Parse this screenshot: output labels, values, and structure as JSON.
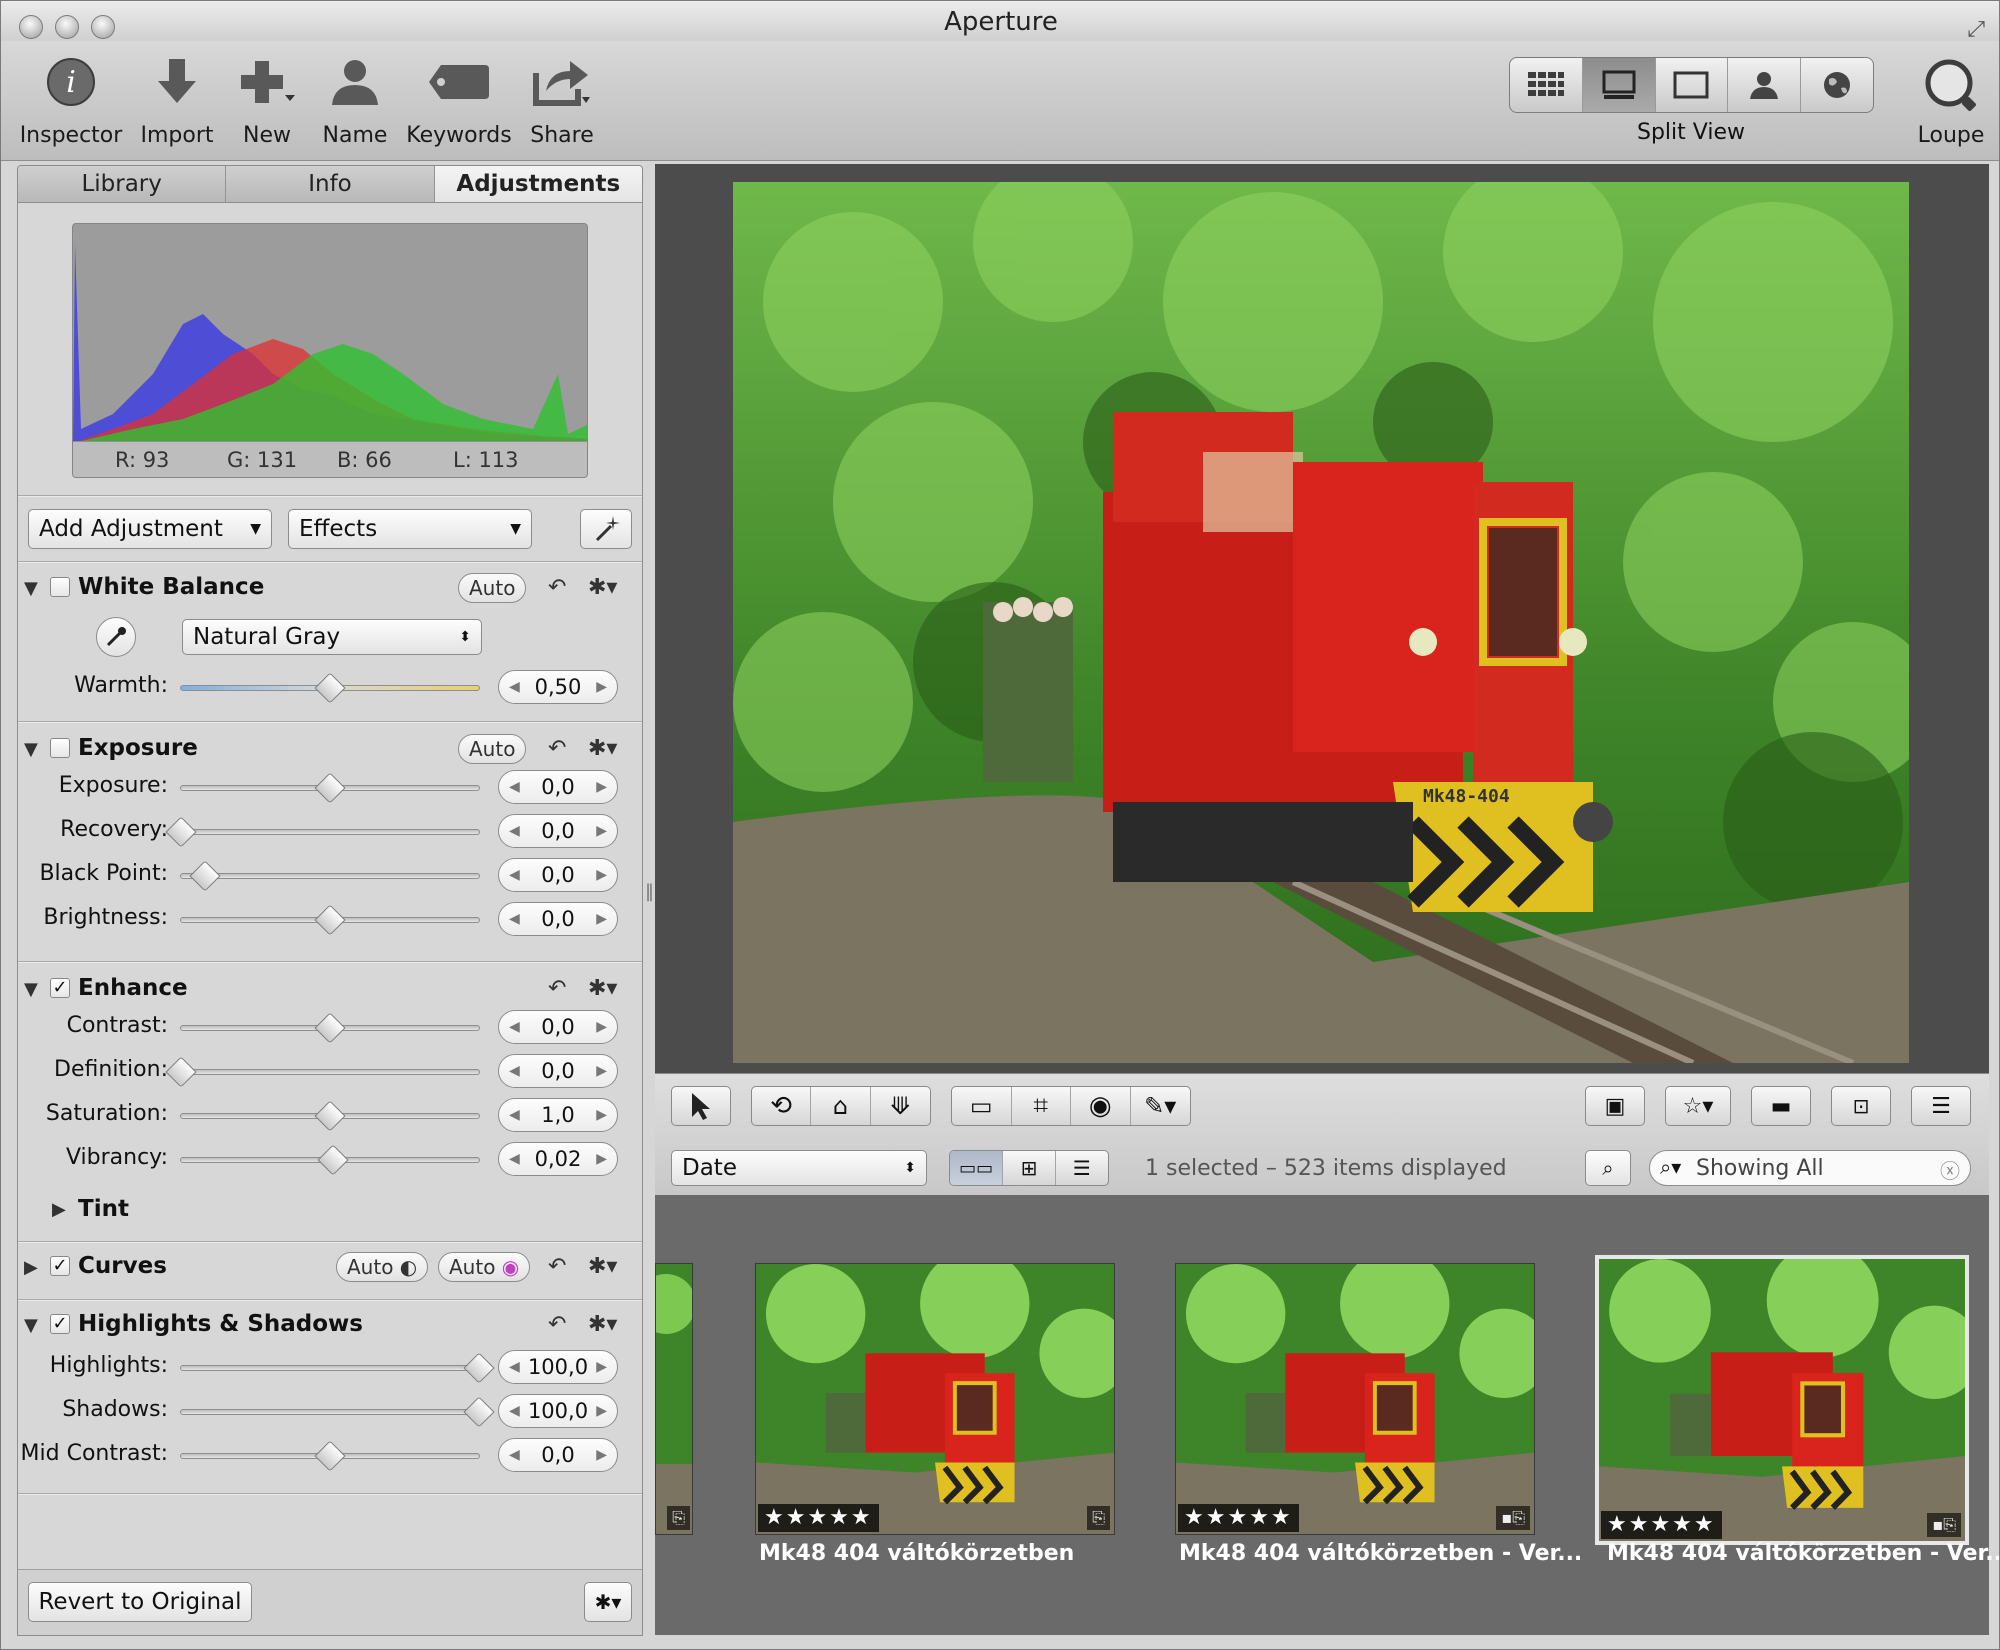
{
  "window": {
    "title": "Aperture"
  },
  "toolbar": {
    "inspector": "Inspector",
    "import": "Import",
    "new": "New",
    "name": "Name",
    "keywords": "Keywords",
    "share": "Share",
    "view_mode": "Split View",
    "loupe": "Loupe"
  },
  "tabs": {
    "library": "Library",
    "info": "Info",
    "adjustments": "Adjustments"
  },
  "histogram": {
    "r": "R: 93",
    "g": "G: 131",
    "b": "B: 66",
    "l": "L: 113"
  },
  "adjust_controls": {
    "add_adjustment": "Add Adjustment",
    "effects": "Effects"
  },
  "white_balance": {
    "title": "White Balance",
    "auto": "Auto",
    "mode": "Natural Gray",
    "warmth_label": "Warmth:",
    "warmth_value": "0,50",
    "warmth_level": 0.5
  },
  "exposure": {
    "title": "Exposure",
    "auto": "Auto",
    "rows": [
      {
        "label": "Exposure:",
        "value": "0,0",
        "level": 0.5
      },
      {
        "label": "Recovery:",
        "value": "0,0",
        "level": 0.0
      },
      {
        "label": "Black Point:",
        "value": "0,0",
        "level": 0.08
      },
      {
        "label": "Brightness:",
        "value": "0,0",
        "level": 0.5
      }
    ]
  },
  "enhance": {
    "title": "Enhance",
    "rows": [
      {
        "label": "Contrast:",
        "value": "0,0",
        "level": 0.5
      },
      {
        "label": "Definition:",
        "value": "0,0",
        "level": 0.0
      },
      {
        "label": "Saturation:",
        "value": "1,0",
        "level": 0.5
      },
      {
        "label": "Vibrancy:",
        "value": "0,02",
        "level": 0.51
      }
    ],
    "tint": "Tint"
  },
  "curves": {
    "title": "Curves",
    "auto1": "Auto",
    "auto2": "Auto"
  },
  "highlights_shadows": {
    "title": "Highlights & Shadows",
    "rows": [
      {
        "label": "Highlights:",
        "value": "100,0",
        "level": 1.0
      },
      {
        "label": "Shadows:",
        "value": "100,0",
        "level": 1.0
      },
      {
        "label": "Mid Contrast:",
        "value": "0,0",
        "level": 0.5
      }
    ]
  },
  "footer": {
    "revert": "Revert to Original"
  },
  "browser": {
    "sort": "Date",
    "status": "1 selected – 523 items displayed",
    "search": "Showing All"
  },
  "photo": {
    "plate": "Mk48-404"
  },
  "thumbnails": [
    {
      "caption": "Mk48 404 váltókörzetben",
      "stars": "★★★★★"
    },
    {
      "caption": "Mk48 404 váltókörzetben - Ver...",
      "stars": "★★★★★"
    },
    {
      "caption": "Mk48 404 váltókörzetben - Ver...",
      "stars": "★★★★★"
    }
  ],
  "colors": {
    "accent_red": "#d8241c",
    "foliage": "#4a8a2a",
    "loco_yellow": "#e0c020"
  }
}
